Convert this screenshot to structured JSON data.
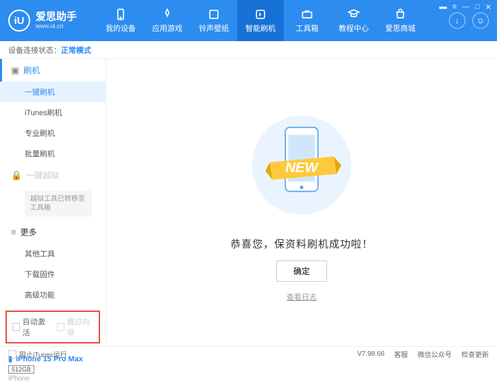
{
  "app": {
    "title": "爱思助手",
    "subtitle": "www.i4.cn"
  },
  "nav": {
    "items": [
      {
        "label": "我的设备"
      },
      {
        "label": "应用游戏"
      },
      {
        "label": "铃声壁纸"
      },
      {
        "label": "智能刷机"
      },
      {
        "label": "工具箱"
      },
      {
        "label": "教程中心"
      },
      {
        "label": "爱思商城"
      }
    ]
  },
  "status": {
    "label": "设备连接状态：",
    "mode": "正常模式"
  },
  "sidebar": {
    "flash": {
      "title": "刷机",
      "items": [
        "一键刷机",
        "iTunes刷机",
        "专业刷机",
        "批量刷机"
      ]
    },
    "jailbreak": {
      "title": "一键越狱",
      "notice": "越狱工具已转移至工具箱"
    },
    "more": {
      "title": "更多",
      "items": [
        "其他工具",
        "下载固件",
        "高级功能"
      ]
    }
  },
  "checkboxes": {
    "autoActivate": "自动激活",
    "skipGuide": "跳过向导"
  },
  "device": {
    "name": "iPhone 15 Pro Max",
    "storage": "512GB",
    "type": "iPhone"
  },
  "main": {
    "successText": "恭喜您，保资料刷机成功啦！",
    "okButton": "确定",
    "logLink": "查看日志",
    "newBadge": "NEW"
  },
  "footer": {
    "blockItunes": "阻止iTunes运行",
    "version": "V7.98.66",
    "support": "客服",
    "wechat": "微信公众号",
    "checkUpdate": "检查更新"
  }
}
